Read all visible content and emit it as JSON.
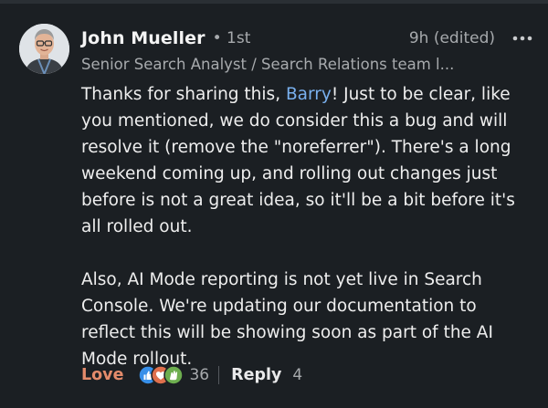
{
  "author": {
    "name": "John Mueller",
    "degree": "• 1st",
    "timestamp": "9h (edited)",
    "headline": "Senior Search Analyst / Search Relations team l..."
  },
  "comment": {
    "p1_before": "Thanks for sharing this, ",
    "mention": "Barry",
    "p1_after": "! Just to be clear, like you mentioned, we do consider this a bug and will resolve it (remove the \"noreferrer\"). There's a long weekend coming up, and rolling out changes just before is not a great idea, so it'll be a bit before it's all rolled out.",
    "p2": "Also, AI Mode reporting is not yet live in Search Console. We're updating our documentation to reflect this will be showing soon as part of the AI Mode rollout."
  },
  "actions": {
    "love_label": "Love",
    "reaction_count": "36",
    "reply_label": "Reply",
    "reply_count": "4"
  },
  "icons": {
    "more": "more-horizontal-icon",
    "reactions": [
      "like-icon",
      "love-icon",
      "celebrate-icon"
    ]
  },
  "colors": {
    "background": "#1b1f23",
    "mention": "#79b0ee",
    "love": "#e48b6b",
    "secondary_text": "#a7aaad"
  }
}
